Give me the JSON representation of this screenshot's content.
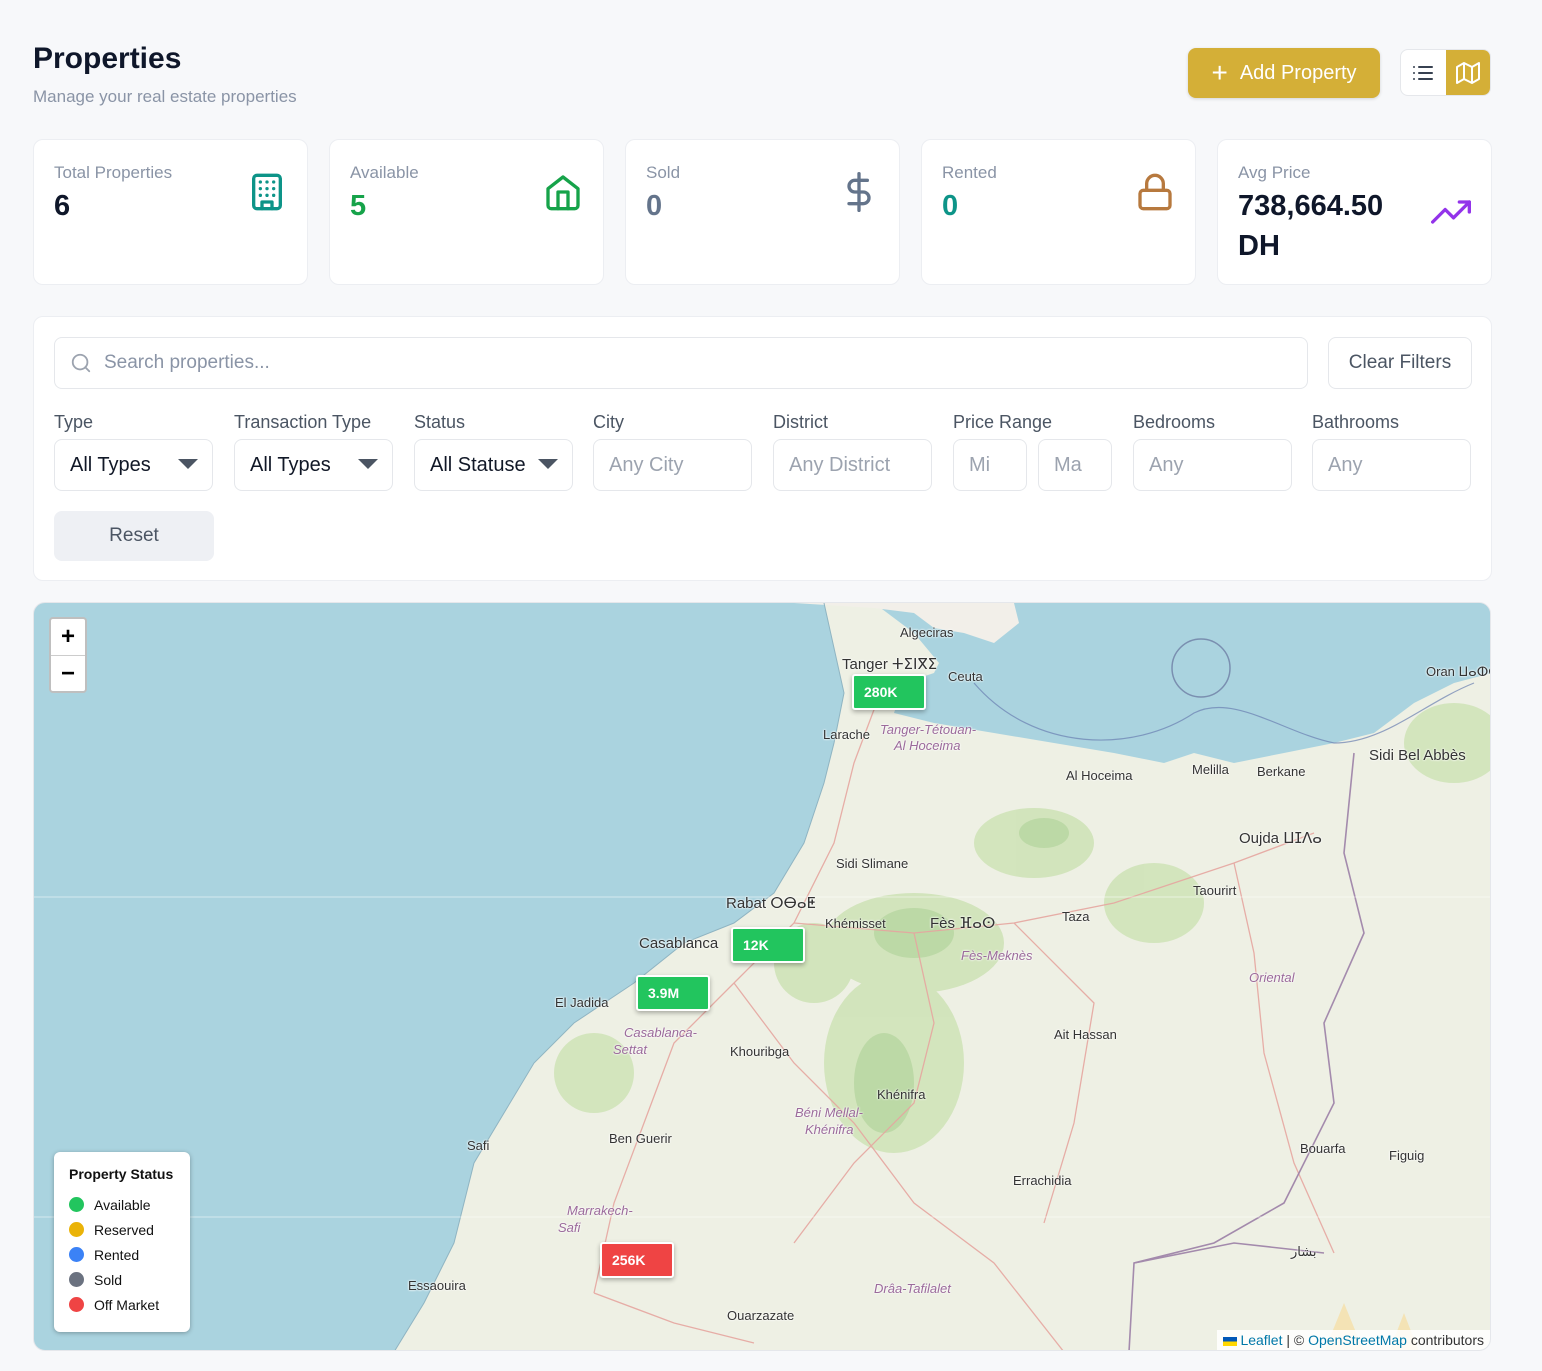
{
  "header": {
    "title": "Properties",
    "subtitle": "Manage your real estate properties",
    "add_button": "Add Property"
  },
  "stats": [
    {
      "label": "Total Properties",
      "value": "6",
      "color": "#0f172a",
      "icon": "building-icon",
      "icon_color": "#0d9488"
    },
    {
      "label": "Available",
      "value": "5",
      "color": "#16a34a",
      "icon": "home-icon",
      "icon_color": "#16a34a"
    },
    {
      "label": "Sold",
      "value": "0",
      "color": "#64748b",
      "icon": "dollar-icon",
      "icon_color": "#64748b"
    },
    {
      "label": "Rented",
      "value": "0",
      "color": "#0d9488",
      "icon": "lock-icon",
      "icon_color": "#b7793e"
    },
    {
      "label": "Avg Price",
      "value": "738,664.50 DH",
      "color": "#0f172a",
      "icon": "trending-up-icon",
      "icon_color": "#9333ea"
    }
  ],
  "filters": {
    "search_placeholder": "Search properties...",
    "clear_label": "Clear Filters",
    "reset_label": "Reset",
    "type": {
      "label": "Type",
      "value": "All Types"
    },
    "transaction": {
      "label": "Transaction Type",
      "value": "All Types"
    },
    "status": {
      "label": "Status",
      "value": "All Statuse"
    },
    "city": {
      "label": "City",
      "placeholder": "Any City"
    },
    "district": {
      "label": "District",
      "placeholder": "Any District"
    },
    "price": {
      "label": "Price Range",
      "min": "Mi",
      "max": "Ma"
    },
    "bedrooms": {
      "label": "Bedrooms",
      "placeholder": "Any"
    },
    "bathrooms": {
      "label": "Bathrooms",
      "placeholder": "Any"
    }
  },
  "map": {
    "zoom_in": "+",
    "zoom_out": "−",
    "markers": [
      {
        "label": "280K",
        "status": "available"
      },
      {
        "label": "12K",
        "status": "available"
      },
      {
        "label": "3.9M",
        "status": "available"
      },
      {
        "label": "256K",
        "status": "off-market"
      }
    ],
    "labels": {
      "algeciras": "Algeciras",
      "tanger": "Tanger ⵜⵉⵏⴳⵉ",
      "ceuta": "Ceuta",
      "oran": "Oran ⵡⴰⵀⵔⴰⵏ",
      "larache": "Larache",
      "tanger_region": "Tanger-Tétouan-",
      "hoceima_region": "Al Hoceima",
      "al_hoceima": "Al Hoceima",
      "melilla": "Melilla",
      "berkane": "Berkane",
      "sidi_bel_abbes": "Sidi Bel Abbès",
      "oujda": "Oujda ⵡⵊⴷⴰ",
      "sidi_slimane": "Sidi Slimane",
      "rabat": "Rabat ⵔⴱⴰⵟ",
      "khemisset": "Khémisset",
      "fes": "Fès ⴼⴰⵙ",
      "taourirt": "Taourirt",
      "taza": "Taza",
      "casablanca": "Casablanca",
      "fes_meknes": "Fès-Meknès",
      "el_jadida": "El Jadida",
      "oriental": "Oriental",
      "casa_settat": "Casablanca-",
      "settat": "Settat",
      "khouribga": "Khouribga",
      "ait_hassan": "Ait Hassan",
      "khenifra": "Khénifra",
      "beni_mellal": "Béni Mellal-",
      "khenifra_region": "Khénifra",
      "safi": "Safi",
      "ben_guerir": "Ben Guerir",
      "bouarfa": "Bouarfa",
      "figuig": "Figuig",
      "errachidia": "Errachidia",
      "marrakech": "Marrakech-",
      "safi_region": "Safi",
      "essaouira": "Essaouira",
      "draa": "Drâa-Tafilalet",
      "ouarzazate": "Ouarzazate",
      "bechar": "بشار"
    },
    "legend": {
      "title": "Property Status",
      "items": [
        {
          "label": "Available",
          "color": "#22c55e"
        },
        {
          "label": "Reserved",
          "color": "#eab308"
        },
        {
          "label": "Rented",
          "color": "#3b82f6"
        },
        {
          "label": "Sold",
          "color": "#6b7280"
        },
        {
          "label": "Off Market",
          "color": "#ef4444"
        }
      ]
    },
    "attribution": {
      "leaflet": "Leaflet",
      "osm": "OpenStreetMap",
      "suffix": "contributors",
      "prefix": "| ©"
    }
  },
  "colors": {
    "accent": "#d4af37",
    "available": "#22c55e",
    "off_market": "#ef4444"
  }
}
